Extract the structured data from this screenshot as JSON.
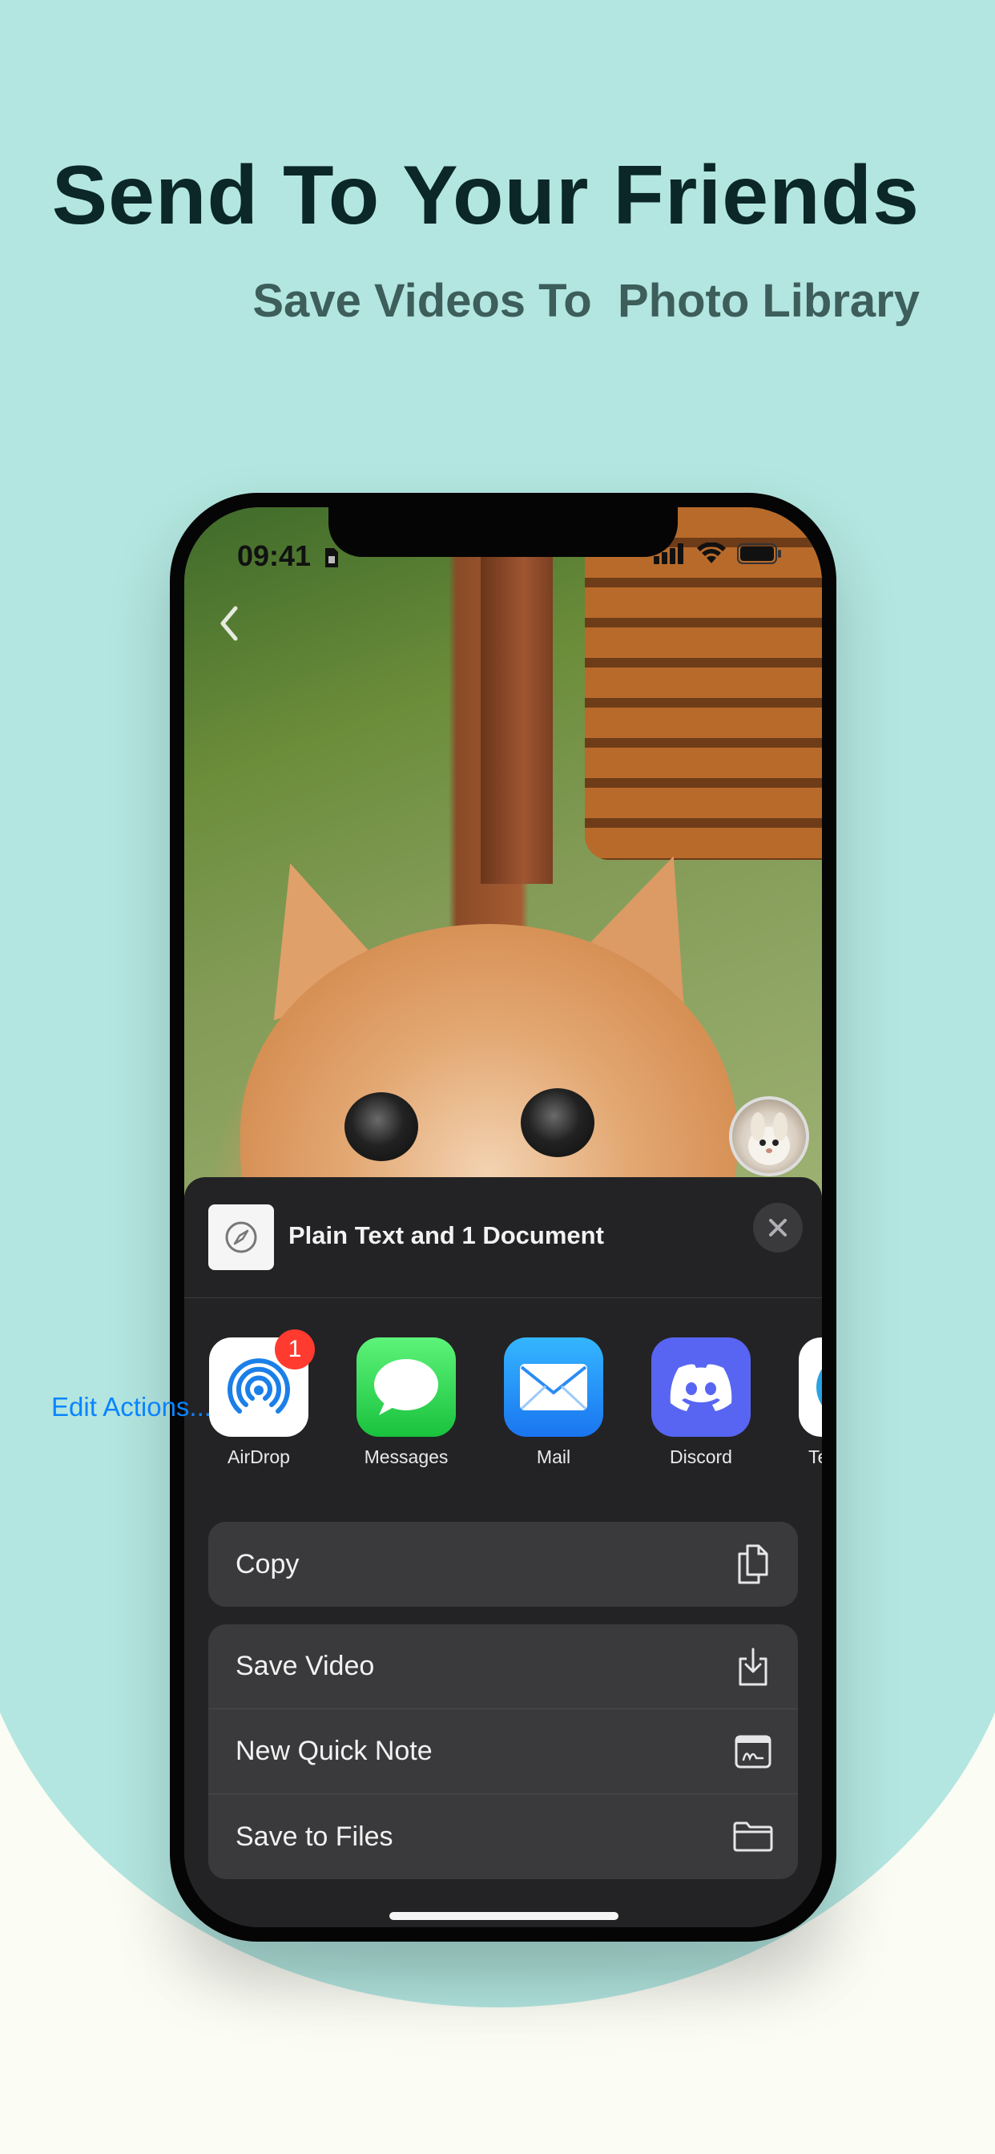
{
  "headline": "Send To Your Friends",
  "subline": "Save Videos To  Photo Library",
  "status_bar": {
    "time": "09:41"
  },
  "share_sheet": {
    "title": "Plain Text and 1 Document",
    "apps": [
      {
        "label": "AirDrop",
        "badge": "1"
      },
      {
        "label": "Messages"
      },
      {
        "label": "Mail"
      },
      {
        "label": "Discord"
      },
      {
        "label": "Te"
      }
    ],
    "actions_group1": [
      {
        "label": "Copy",
        "icon": "copy-icon"
      }
    ],
    "actions_group2": [
      {
        "label": "Save Video",
        "icon": "download-icon"
      },
      {
        "label": "New Quick Note",
        "icon": "quick-note-icon"
      },
      {
        "label": "Save to Files",
        "icon": "folder-icon"
      }
    ],
    "edit_actions": "Edit Actions..."
  },
  "colors": {
    "background_teal": "#b3e6e0",
    "background_cream": "#fbfcf4",
    "headline": "#0b2727",
    "subline": "#3d5e5b",
    "sheet": "#232325",
    "link_blue": "#0a84ff",
    "badge_red": "#ff3b30"
  }
}
